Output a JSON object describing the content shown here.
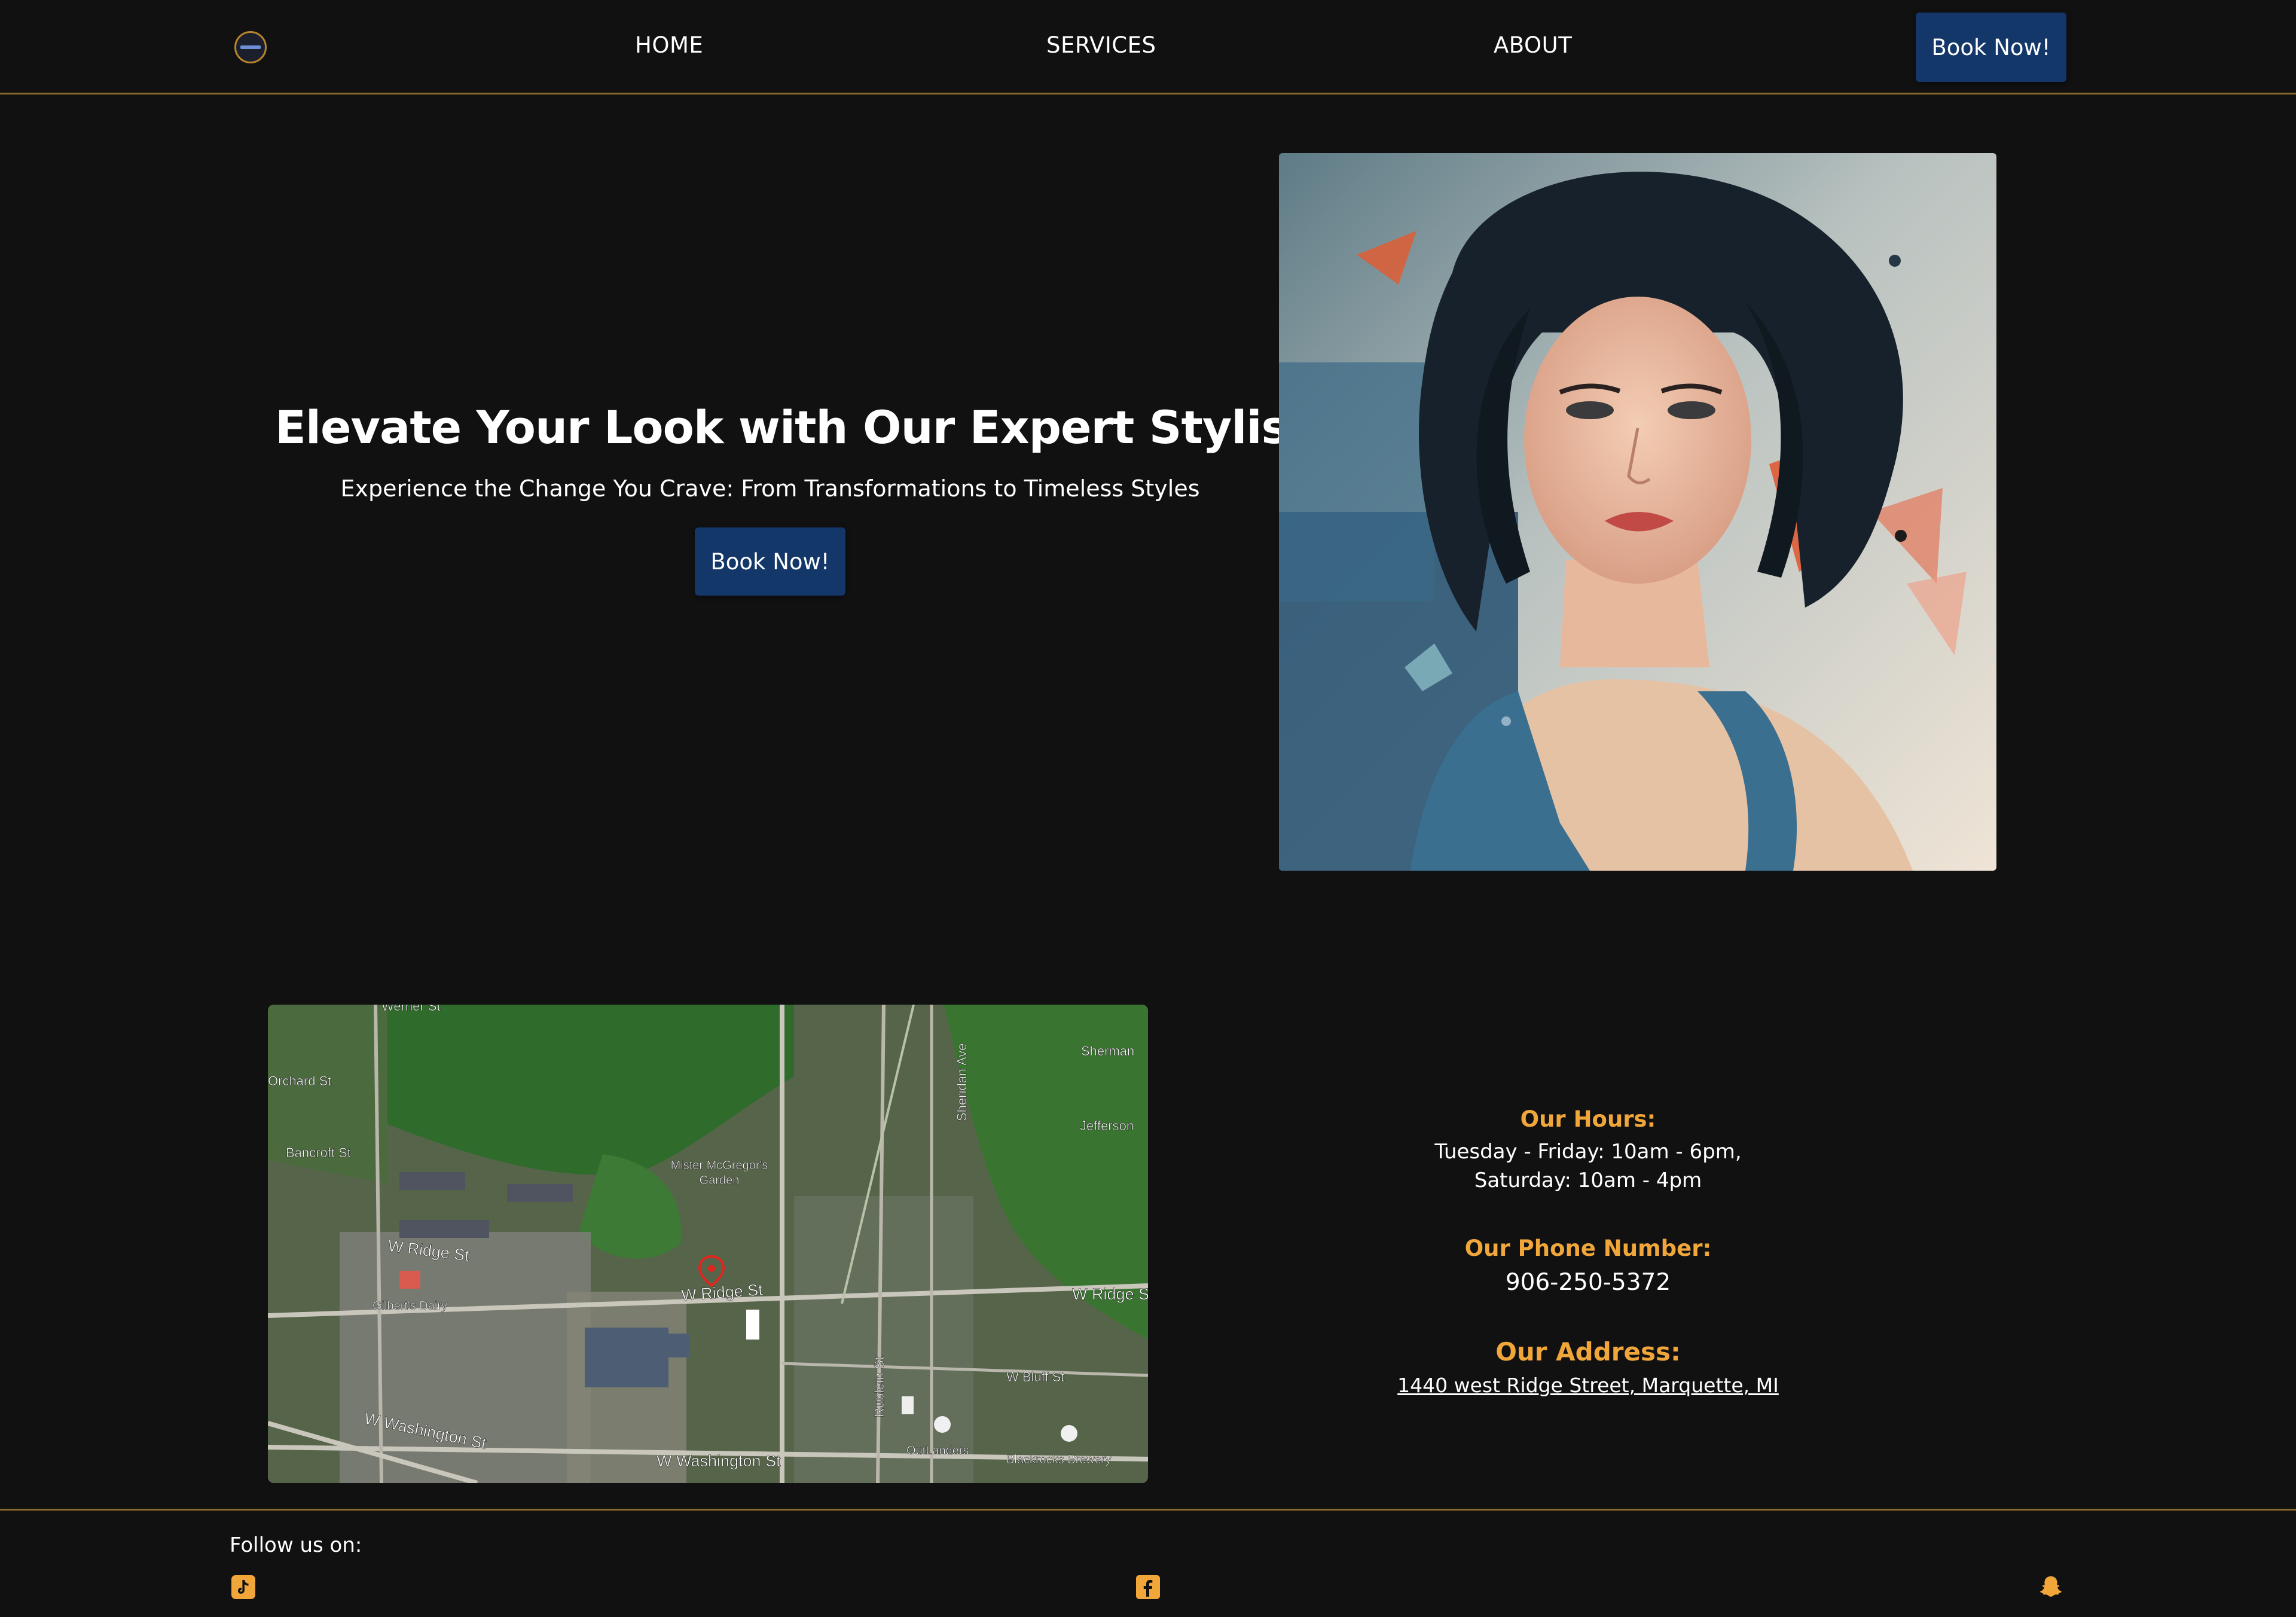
{
  "nav": {
    "home": "HOME",
    "services": "SERVICES",
    "about": "ABOUT",
    "book": "Book Now!"
  },
  "hero": {
    "title": "Elevate Your Look with Our Expert Stylists",
    "subtitle": "Experience the Change You Crave: From Transformations to Timeless Styles",
    "book": "Book Now!"
  },
  "map": {
    "labels": {
      "werner": "Werner St",
      "orchard": "Orchard St",
      "bancroft": "Bancroft St",
      "sherman": "Sherman",
      "jefferson": "Jefferson",
      "sheridan": "Sheridan Ave",
      "mcgregor_1": "Mister McGregor's",
      "mcgregor_2": "Garden",
      "ridge_1": "W Ridge St",
      "ridge_2": "W Ridge St",
      "ridge_3": "W Ridge S",
      "gilberts": "Gilbert's Dairy",
      "bluff": "W Bluff St",
      "rublein": "Rublein St",
      "washington_1": "W Washington St",
      "washington_2": "W Washington St",
      "outlanders": "OutLanders",
      "blackrocks": "Blackrocks Brewery"
    }
  },
  "info": {
    "hours_heading": "Our Hours:",
    "hours_line1": "Tuesday - Friday: 10am - 6pm,",
    "hours_line2": "Saturday: 10am - 4pm",
    "phone_heading": "Our Phone Number:",
    "phone": "906-250-5372",
    "address_heading": "Our Address:",
    "address": "1440 west Ridge Street, Marquette, MI"
  },
  "footer": {
    "follow": "Follow us on:",
    "icons": [
      "tiktok-icon",
      "facebook-icon",
      "snapchat-icon"
    ]
  },
  "colors": {
    "background": "#111112",
    "accent": "#f1a63a",
    "button": "#143769",
    "divider": "#8a6a2c"
  }
}
